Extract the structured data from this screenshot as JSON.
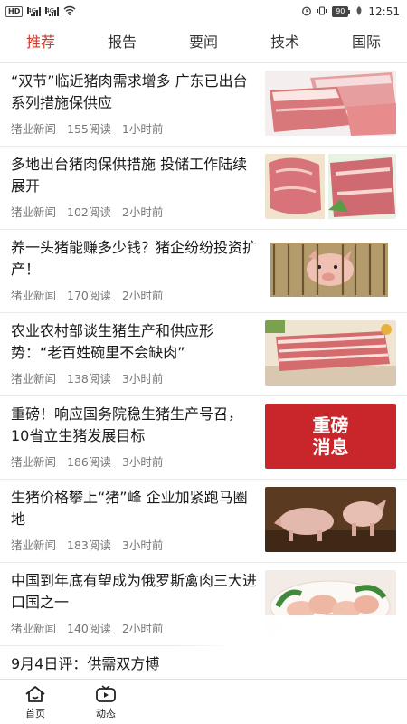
{
  "status_bar": {
    "hd": "HD",
    "network1": "4G",
    "network2": "4G",
    "battery": "90",
    "time": "12:51"
  },
  "tabs": [
    {
      "label": "推荐",
      "active": true
    },
    {
      "label": "报告",
      "active": false
    },
    {
      "label": "要闻",
      "active": false
    },
    {
      "label": "技术",
      "active": false
    },
    {
      "label": "国际",
      "active": false
    }
  ],
  "news": [
    {
      "title": "“双节”临近猪肉需求增多 广东已出台系列措施保供应",
      "source": "猪业新闻",
      "reads": "155阅读",
      "time": "1小时前",
      "thumb": "pork-slabs"
    },
    {
      "title": "多地出台猪肉保供措施 投储工作陆续展开",
      "source": "猪业新闻",
      "reads": "102阅读",
      "time": "2小时前",
      "thumb": "pork-cuts"
    },
    {
      "title": "养一头猪能赚多少钱？猪企纷纷投资扩产！",
      "source": "猪业新闻",
      "reads": "170阅读",
      "time": "2小时前",
      "thumb": "pig-cage"
    },
    {
      "title": "农业农村部谈生猪生产和供应形势：“老百姓碗里不会缺肉”",
      "source": "猪业新闻",
      "reads": "138阅读",
      "time": "3小时前",
      "thumb": "pork-belly"
    },
    {
      "title": "重磅！响应国务院稳生猪生产号召，10省立生猪发展目标",
      "source": "猪业新闻",
      "reads": "186阅读",
      "time": "3小时前",
      "thumb": "news-banner",
      "banner_line1": "重磅",
      "banner_line2": "消息"
    },
    {
      "title": "生猪价格攀上“猪”峰 企业加紧跑马圈地",
      "source": "猪业新闻",
      "reads": "183阅读",
      "time": "3小时前",
      "thumb": "pigs-farm"
    },
    {
      "title": "中国到年底有望成为俄罗斯禽肉三大进口国之一",
      "source": "猪业新闻",
      "reads": "140阅读",
      "time": "2小时前",
      "thumb": "poultry"
    }
  ],
  "partial_item": {
    "title": "9月4日评：供需双方博"
  },
  "bottom_nav": [
    {
      "label": "首页",
      "icon": "home-icon"
    },
    {
      "label": "动态",
      "icon": "tv-icon"
    }
  ],
  "colors": {
    "accent": "#c8392b",
    "banner": "#c8262a"
  }
}
